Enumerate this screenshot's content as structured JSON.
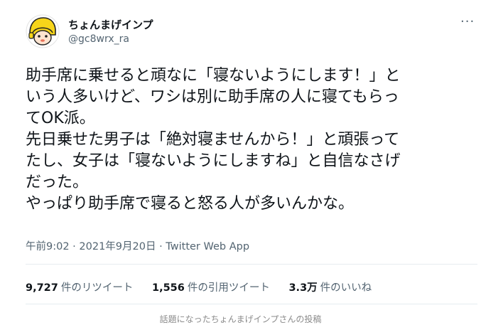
{
  "author": {
    "name": "ちょんまげインプ",
    "handle": "@gc8wrx_ra"
  },
  "more_label": "···",
  "tweet": {
    "text": "助手席に乗せると頑なに「寝ないようにします！」と\nいう人多いけど、ワシは別に助手席の人に寝てもらっ\nてOK派。\n先日乗せた男子は「絶対寝ませんから！」と頑張って\nたし、女子は「寝ないようにしますね」と自信なさげ\nだった。\nやっぱり助手席で寝ると怒る人が多いんかな。",
    "meta": "午前9:02 · 2021年9月20日 · Twitter Web App"
  },
  "stats": {
    "retweets": {
      "count": "9,727",
      "label": "件のリツイート"
    },
    "quotes": {
      "count": "1,556",
      "label": "件の引用ツイート"
    },
    "likes": {
      "count": "3.3万",
      "label": "件のいいね"
    }
  },
  "caption": "話題になったちょんまげインプさんの投稿",
  "colors": {
    "text": "#0f1419",
    "secondary": "#536471",
    "avatar_yellow": "#f7d51a"
  },
  "icons": {
    "avatar": "yellow-helmet-character-avatar"
  }
}
